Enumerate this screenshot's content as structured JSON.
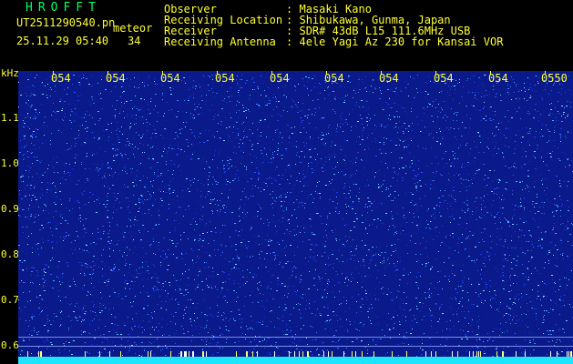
{
  "header": {
    "logo": "HROFFT",
    "filename": "UT2511290540.pn",
    "mode": "meteor",
    "datetime": "25.11.29 05:40",
    "count": "34"
  },
  "info": [
    {
      "key": "Observer",
      "sep": ":",
      "value": "Masaki Kano"
    },
    {
      "key": "Receiving Location",
      "sep": ":",
      "value": "Shibukawa, Gunma, Japan"
    },
    {
      "key": "Receiver",
      "sep": ":",
      "value": "SDR# 43dB L15 111.6MHz USB"
    },
    {
      "key": "Receiving Antenna",
      "sep": ":",
      "value": "4ele Yagi Az 230 for Kansai VOR"
    }
  ],
  "yaxis": {
    "unit": "kHz",
    "labels": [
      "1.1",
      "1.0",
      "0.9",
      "0.8",
      "0.7",
      "0.6"
    ]
  },
  "xaxis": {
    "ticks": [
      "054",
      "054",
      "054",
      "054",
      "054",
      "054",
      "054",
      "054",
      "054",
      "0550"
    ]
  },
  "colors": {
    "background": "#000000",
    "header_text": "#ffff33",
    "logo": "#00ff66",
    "spectrum_base": "#0a1a8a",
    "noise_bright": "#4fb0ff",
    "baseline_band": "#1ee5ff"
  }
}
